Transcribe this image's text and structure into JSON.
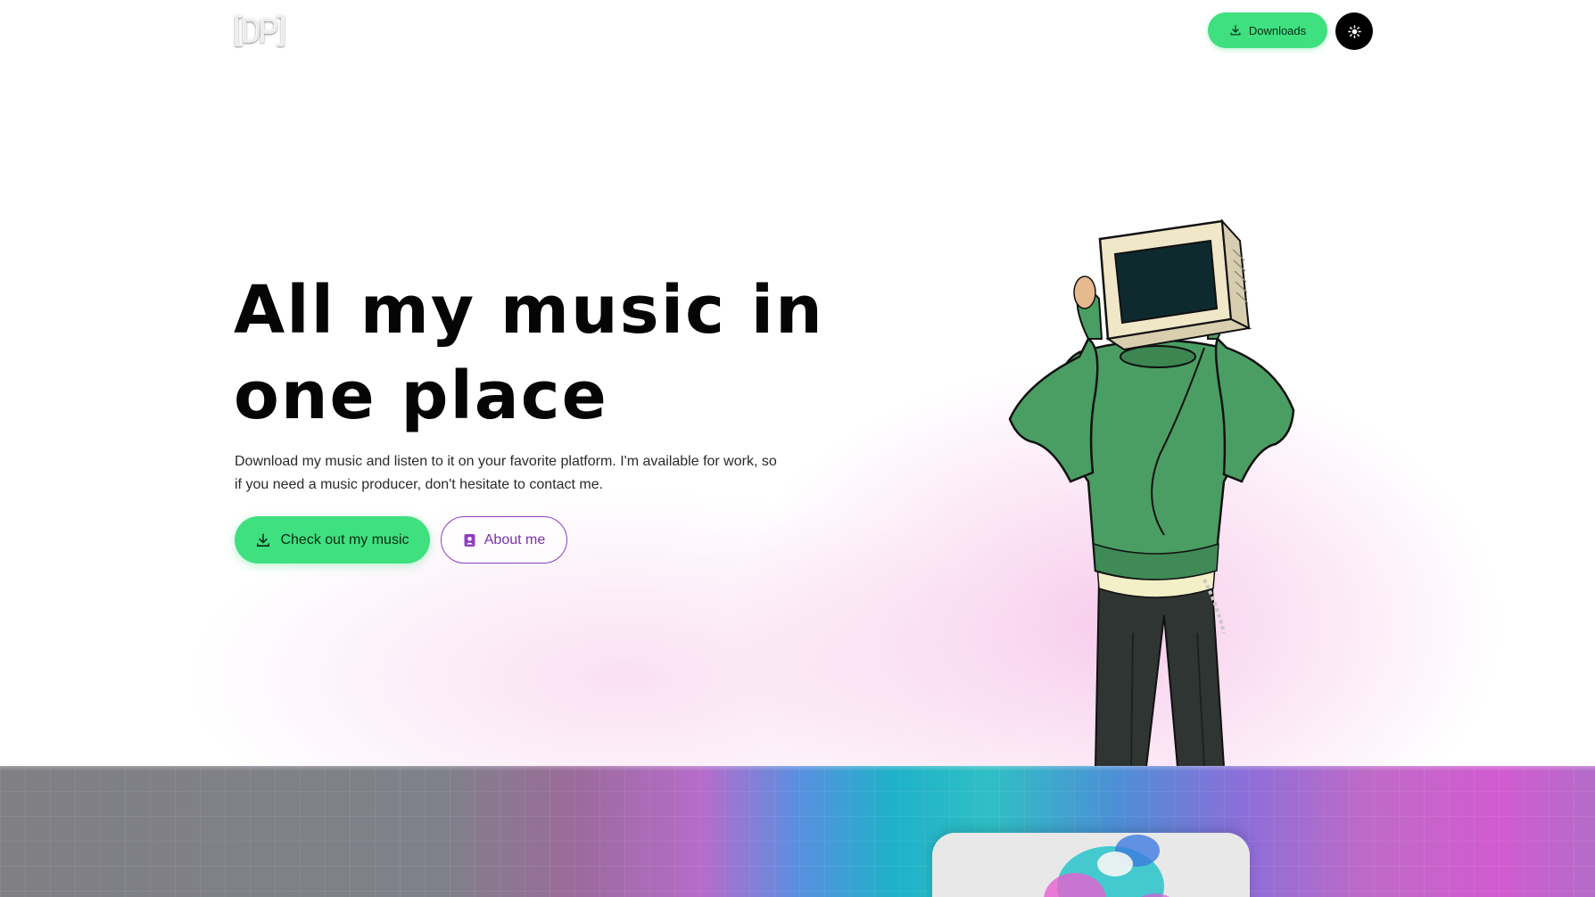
{
  "header": {
    "logo_text": "[DP]",
    "downloads_label": "Downloads",
    "theme_toggle_icon": "sun-icon"
  },
  "hero": {
    "title_line1": "All my music in",
    "title_line2": "one place",
    "description": "Download my music and listen to it on your favorite platform. I'm available for work, so if you need a music producer, don't hesitate to contact me.",
    "primary_button_label": "Check out my music",
    "secondary_button_label": "About me"
  },
  "icons": {
    "download": "download-icon",
    "about": "contact-card-icon",
    "theme": "sun-icon"
  },
  "colors": {
    "accent_green": "#3ee07f",
    "accent_purple": "#8e3fbf",
    "text_dark": "#050505"
  }
}
